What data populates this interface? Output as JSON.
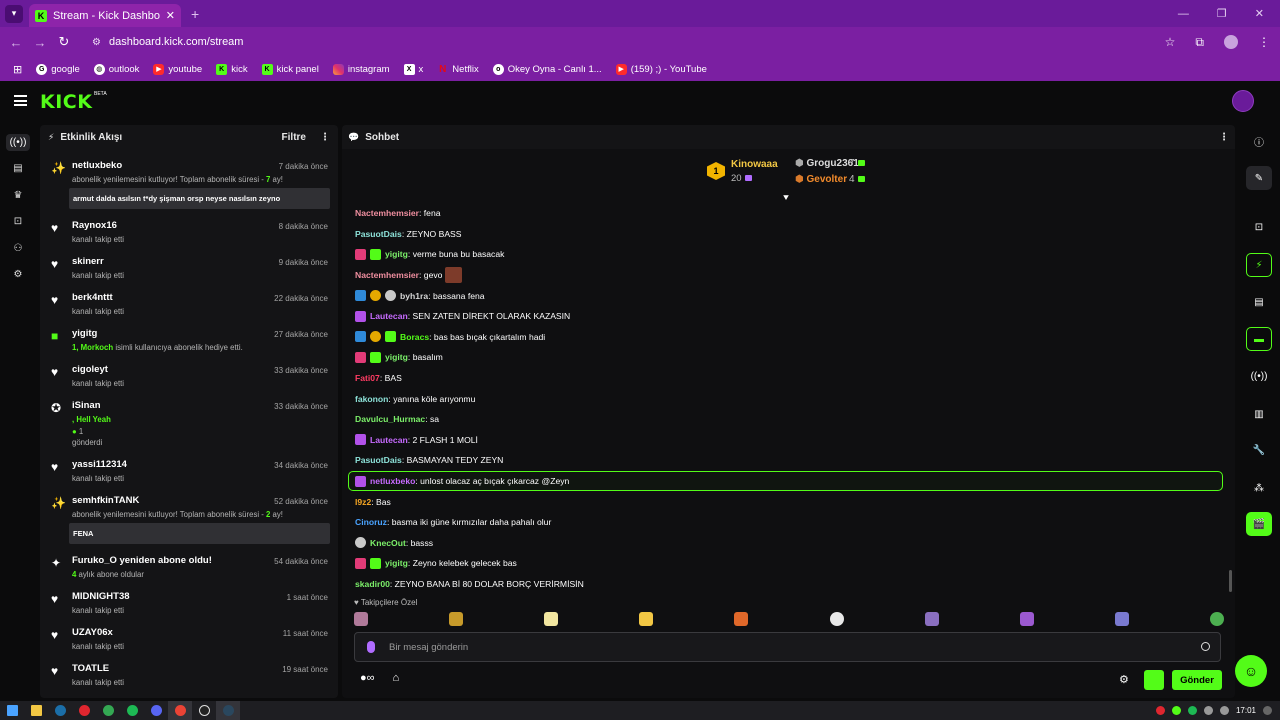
{
  "browser": {
    "tab_title": "Stream - Kick Dashboard",
    "url": "dashboard.kick.com/stream",
    "bookmarks": [
      {
        "label": "google",
        "icon": "google-icon"
      },
      {
        "label": "outlook",
        "icon": "globe-icon"
      },
      {
        "label": "youtube",
        "icon": "youtube-icon"
      },
      {
        "label": "kick",
        "icon": "kick-icon"
      },
      {
        "label": "kick panel",
        "icon": "kick-icon"
      },
      {
        "label": "instagram",
        "icon": "instagram-icon"
      },
      {
        "label": "x",
        "icon": "x-icon"
      },
      {
        "label": "Netflix",
        "icon": "netflix-icon"
      },
      {
        "label": "Okey Oyna - Canlı 1...",
        "icon": "okey-icon"
      },
      {
        "label": "(159) ;) - YouTube",
        "icon": "youtube-icon"
      }
    ]
  },
  "header": {
    "logo": "KICK",
    "beta": "BETA"
  },
  "activity": {
    "title": "Etkinlik Akışı",
    "filter_label": "Filtre",
    "events": [
      {
        "type": "resub",
        "name": "netluxbeko",
        "time": "7 dakika önce",
        "sub_prefix": "abonelik yenilemesini kutluyor! Toplam abonelik süresi - ",
        "sub_hl": "7",
        "sub_suffix": " ay!",
        "message": "armut dalda asılsın t*dy şişman orsp neyse nasılsın zeyno"
      },
      {
        "type": "follow",
        "name": "Raynox16",
        "time": "8 dakika önce",
        "sub": "kanalı takip etti"
      },
      {
        "type": "follow",
        "name": "skinerr",
        "time": "9 dakika önce",
        "sub": "kanalı takip etti"
      },
      {
        "type": "follow",
        "name": "berk4nttt",
        "time": "22 dakika önce",
        "sub": "kanalı takip etti"
      },
      {
        "type": "gift",
        "name": "yigitg",
        "time": "27 dakika önce",
        "sub_hl": "1, Morkoch",
        "sub_suffix": " isimli kullanıcıya abonelik hediye etti."
      },
      {
        "type": "follow",
        "name": "cigoleyt",
        "time": "33 dakika önce",
        "sub": "kanalı takip etti"
      },
      {
        "type": "kicks",
        "name": "iSinan",
        "time": "33 dakika önce",
        "line1": ", Hell Yeah",
        "line2": "1",
        "line3": "gönderdi"
      },
      {
        "type": "follow",
        "name": "yassi112314",
        "time": "34 dakika önce",
        "sub": "kanalı takip etti"
      },
      {
        "type": "resub",
        "name": "semhfkinTANK",
        "time": "52 dakika önce",
        "sub_prefix": "abonelik yenilemesini kutluyor! Toplam abonelik süresi - ",
        "sub_hl": "2",
        "sub_suffix": " ay!",
        "message": "FENA"
      },
      {
        "type": "newsub",
        "name": "Furuko_O yeniden abone oldu!",
        "time": "54 dakika önce",
        "sub_hl": "4",
        "sub_suffix": " aylık abone oldular"
      },
      {
        "type": "follow",
        "name": "MIDNIGHT38",
        "time": "1 saat önce",
        "sub": "kanalı takip etti"
      },
      {
        "type": "follow",
        "name": "UZAY06x",
        "time": "11 saat önce",
        "sub": "kanalı takip etti"
      },
      {
        "type": "follow",
        "name": "TOATLE",
        "time": "19 saat önce",
        "sub": "kanalı takip etti"
      }
    ]
  },
  "chat": {
    "title": "Sohbet",
    "leaderboard": [
      {
        "rank": "1",
        "name": "Kinowaaa",
        "count": "20"
      },
      {
        "name": "Grogu2361",
        "count": "7"
      },
      {
        "name": "Gevolter",
        "count": "4"
      }
    ],
    "messages": [
      {
        "user": "Nactemhemsier",
        "color": "#f08fa0",
        "badges": [],
        "text": "fena"
      },
      {
        "user": "PasuotDais",
        "color": "#8de2d9",
        "badges": [],
        "text": "ZEYNO BASS"
      },
      {
        "user": "yigitg",
        "color": "#7cf06a",
        "badges": [
          "pink",
          "green"
        ],
        "text": "verme buna bu basacak"
      },
      {
        "user": "Nactemhemsier",
        "color": "#f08fa0",
        "badges": [],
        "text": "gevo",
        "emote": true
      },
      {
        "user": "byh1ra",
        "color": "#d7d7d7",
        "badges": [
          "blue",
          "gold",
          "gray"
        ],
        "text": "bassana fena"
      },
      {
        "user": "Lautecan",
        "color": "#c76bff",
        "badges": [
          "purple"
        ],
        "text": "SEN ZATEN DİREKT OLARAK KAZASIN"
      },
      {
        "user": "Boracs",
        "color": "#53fc18",
        "badges": [
          "blue",
          "gold",
          "green"
        ],
        "text": "bas bas bıçak çıkartalım hadi"
      },
      {
        "user": "yigitg",
        "color": "#7cf06a",
        "badges": [
          "pink",
          "green"
        ],
        "text": "basalım"
      },
      {
        "user": "Fati07",
        "color": "#ff3c64",
        "badges": [],
        "text": "BAS"
      },
      {
        "user": "fakonon",
        "color": "#8de2d9",
        "badges": [],
        "text": "yanına köle arıyonmu"
      },
      {
        "user": "Davulcu_Hurmac",
        "color": "#7cf06a",
        "badges": [],
        "text": "sa"
      },
      {
        "user": "Lautecan",
        "color": "#c76bff",
        "badges": [
          "purple"
        ],
        "text": "2 FLASH 1 MOLİ"
      },
      {
        "user": "PasuotDais",
        "color": "#8de2d9",
        "badges": [],
        "text": "BASMAYAN TEDY ZEYN"
      },
      {
        "user": "netluxbeko",
        "color": "#c76bff",
        "badges": [
          "purple"
        ],
        "text": "unlost olacaz aç bıçak çıkarcaz @Zeyn",
        "highlight": true
      },
      {
        "user": "l9z2",
        "color": "#f6a623",
        "badges": [],
        "text": "Bas"
      },
      {
        "user": "Cinoruz",
        "color": "#4aa3ff",
        "badges": [],
        "text": "basma iki güne kırmızılar daha pahalı olur"
      },
      {
        "user": "KnecOut",
        "color": "#7cf06a",
        "badges": [
          "gray"
        ],
        "text": "basss"
      },
      {
        "user": "yigitg",
        "color": "#7cf06a",
        "badges": [
          "pink",
          "green"
        ],
        "text": "Zeyno kelebek gelecek bas"
      },
      {
        "user": "skadir00",
        "color": "#7cf06a",
        "badges": [],
        "text": "ZEYNO BANA Bİ 80 DOLAR BORÇ VERİRMİSİN"
      }
    ],
    "followers_label": "Takipçilere Özel",
    "input_placeholder": "Bir mesaj gönderin",
    "send_label": "Gönder"
  },
  "taskbar": {
    "time": "17:01"
  }
}
